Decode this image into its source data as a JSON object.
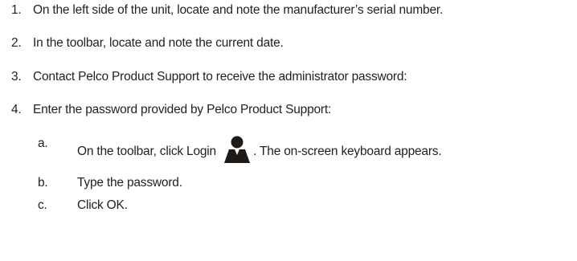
{
  "steps": [
    {
      "number": "1.",
      "text": "On the left side of the unit, locate and note the manufacturer’s serial number."
    },
    {
      "number": "2.",
      "text": "In the toolbar, locate and note the current date."
    },
    {
      "number": "3.",
      "text": "Contact Pelco Product Support to receive the administrator password:"
    },
    {
      "number": "4.",
      "text": "Enter the password provided by Pelco Product Support:"
    }
  ],
  "substeps": [
    {
      "letter": "a.",
      "text_before_icon": "On the toolbar, click Login",
      "icon": "login-person-icon",
      "text_after_icon": ". The on-screen keyboard appears."
    },
    {
      "letter": "b.",
      "text": "Type the password."
    },
    {
      "letter": "c.",
      "text": "Click OK."
    }
  ],
  "colors": {
    "text": "#231f20",
    "icon": "#1f1a17"
  }
}
